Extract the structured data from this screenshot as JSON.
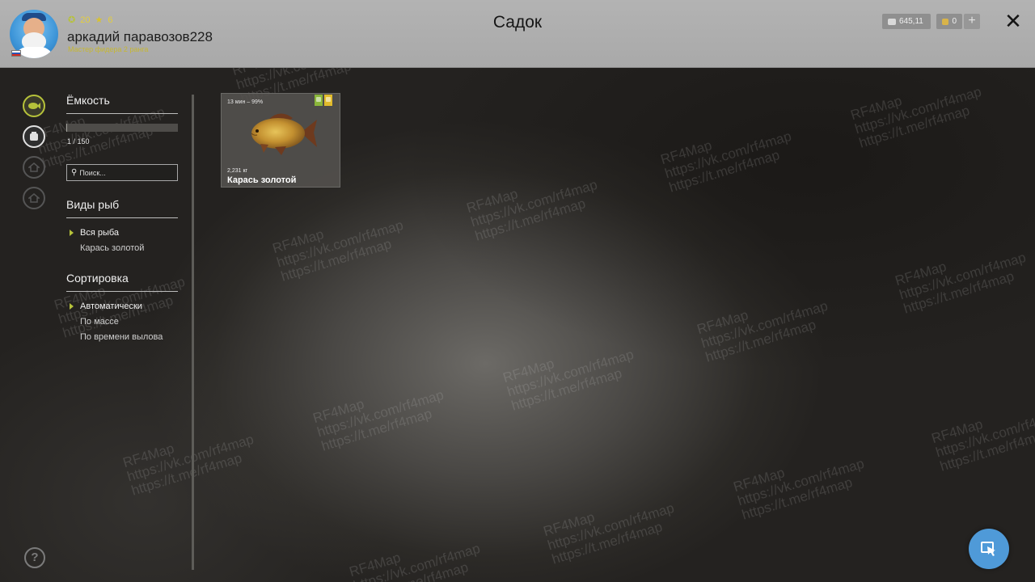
{
  "header": {
    "title": "Садок",
    "username": "аркадий паравозов228",
    "rank": "Мастер фидера 2 ранга",
    "level": "20",
    "stars": "6",
    "silver": "645,11",
    "gold": "0",
    "plus_label": "+",
    "close_label": "✕"
  },
  "sidebar": {
    "capacity_title": "Ёмкость",
    "capacity_text": "1 / 150",
    "capacity_fraction": 0.0067,
    "search_placeholder": "Поиск...",
    "species_title": "Виды рыб",
    "species": [
      {
        "label": "Вся рыба",
        "selected": true
      },
      {
        "label": "Карась золотой",
        "selected": false
      }
    ],
    "sort_title": "Сортировка",
    "sort": [
      {
        "label": "Автоматически",
        "selected": true
      },
      {
        "label": "По массе",
        "selected": false
      },
      {
        "label": "По времени вылова",
        "selected": false
      }
    ]
  },
  "fish": [
    {
      "time_freshness": "13 мин – 99%",
      "weight": "2,231 кг",
      "name": "Карась золотой"
    }
  ],
  "help_label": "?",
  "watermark": {
    "brand": "RF4Map",
    "vk": "https://vk.com/rf4map",
    "tg": "https://t.me/rf4map"
  },
  "colors": {
    "accent": "#b6c23a",
    "header_bg": "#b0b0b0",
    "cursor_button": "#4f9ad8"
  }
}
